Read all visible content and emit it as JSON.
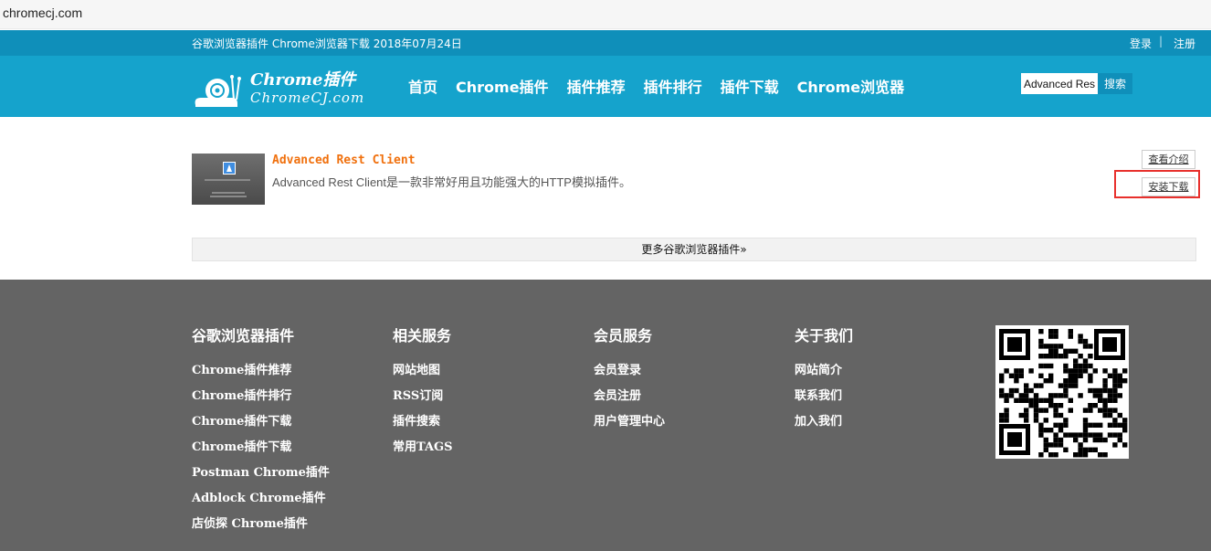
{
  "browser": {
    "url": "chromecj.com"
  },
  "topbar": {
    "date_text": "谷歌浏览器插件 Chrome浏览器下载 2018年07月24日",
    "login": "登录",
    "separator": "|",
    "register": "注册"
  },
  "logo": {
    "line1": "Chrome插件",
    "line2": "ChromeCJ.com"
  },
  "nav": [
    {
      "label": "首页"
    },
    {
      "label": "Chrome插件"
    },
    {
      "label": "插件推荐"
    },
    {
      "label": "插件排行"
    },
    {
      "label": "插件下载"
    },
    {
      "label": "Chrome浏览器"
    }
  ],
  "search": {
    "value": "Advanced Rest",
    "button": "搜索"
  },
  "result": {
    "title": "Advanced Rest Client",
    "description": "Advanced Rest Client是一款非常好用且功能强大的HTTP模拟插件。",
    "intro_button": "查看介绍",
    "install_button": "安装下载"
  },
  "more_link": "更多谷歌浏览器插件»",
  "footer": {
    "columns": [
      {
        "heading": "谷歌浏览器插件",
        "links": [
          "Chrome插件推荐",
          "Chrome插件排行",
          "Chrome插件下载",
          "Chrome插件下载",
          "Postman Chrome插件",
          "Adblock Chrome插件",
          "店侦探 Chrome插件"
        ]
      },
      {
        "heading": "相关服务",
        "links": [
          "网站地图",
          "RSS订阅",
          "插件搜索",
          "常用TAGS"
        ]
      },
      {
        "heading": "会员服务",
        "links": [
          "会员登录",
          "会员注册",
          "用户管理中心"
        ]
      },
      {
        "heading": "关于我们",
        "links": [
          "网站简介",
          "联系我们",
          "加入我们"
        ]
      }
    ]
  },
  "colors": {
    "topbar": "#0f8fba",
    "header": "#15a3cc",
    "footer": "#646464",
    "title": "#f0700d",
    "highlight": "#e8302c"
  }
}
